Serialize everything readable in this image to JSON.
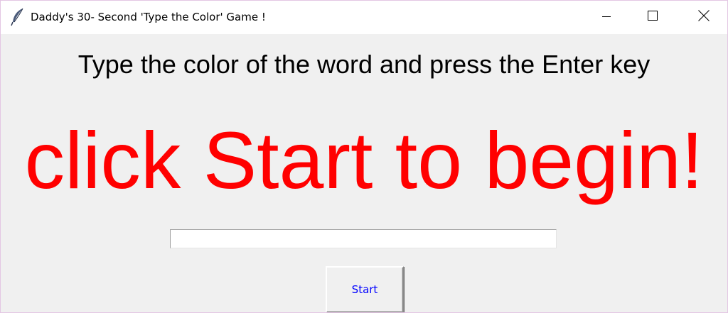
{
  "window": {
    "title": "Daddy's 30- Second 'Type the Color' Game !",
    "icon": "feather-icon",
    "controls": [
      "minimize-icon",
      "maximize-icon",
      "close-icon"
    ]
  },
  "main": {
    "instruction": "Type the color of the word and press the Enter key",
    "color_word": "click Start to begin!",
    "color_word_color": "#ff0000",
    "entry": {
      "value": "",
      "placeholder": ""
    },
    "start_button_label": "Start",
    "start_button_color": "#0000ff"
  },
  "colors": {
    "background": "#f0f0f0",
    "titlebar": "#ffffff"
  }
}
